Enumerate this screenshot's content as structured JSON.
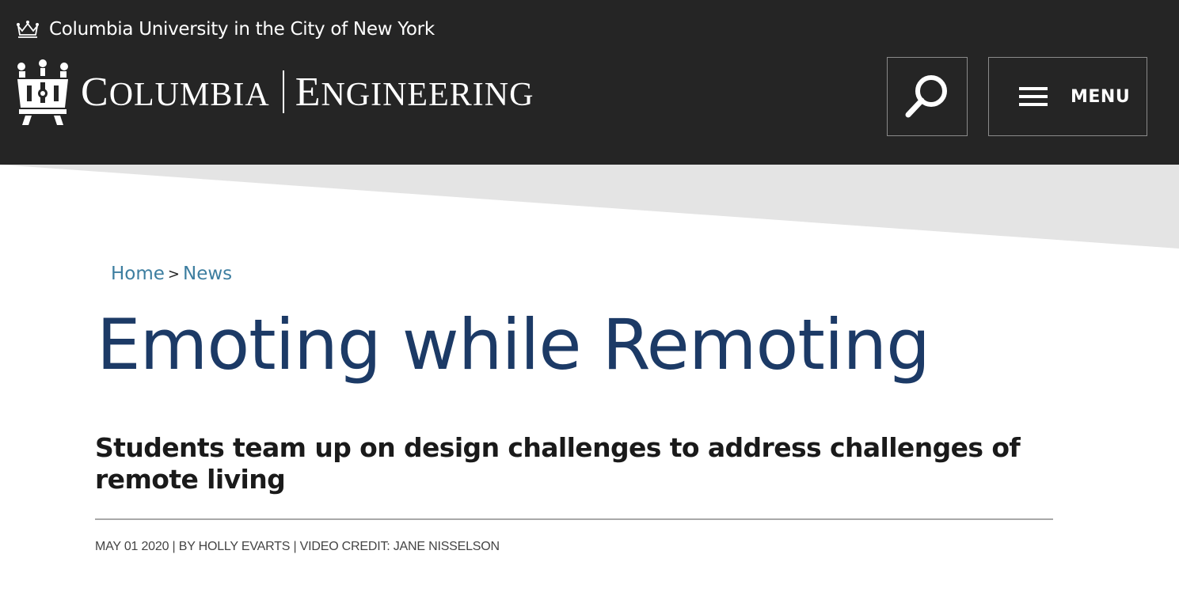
{
  "header": {
    "university_link": "Columbia University in the City of New York",
    "logo": {
      "left_word_initial": "C",
      "left_word_rest": "OLUMBIA",
      "right_word_initial": "E",
      "right_word_rest": "NGINEERING"
    },
    "search_icon": "magnifier-icon",
    "menu_label": "MENU",
    "menu_icon": "hamburger-icon",
    "background_color": "#252525"
  },
  "breadcrumb": {
    "items": [
      "Home",
      "News"
    ],
    "separator": ">"
  },
  "article": {
    "title": "Emoting while Remoting",
    "subtitle": "Students team up on design challenges to address challenges of remote living",
    "meta": "MAY 01 2020 | BY HOLLY EVARTS | VIDEO CREDIT: JANE NISSELSON"
  },
  "colors": {
    "title": "#1c3a66",
    "link": "#3d7ea0",
    "band": "#e4e4e4"
  }
}
